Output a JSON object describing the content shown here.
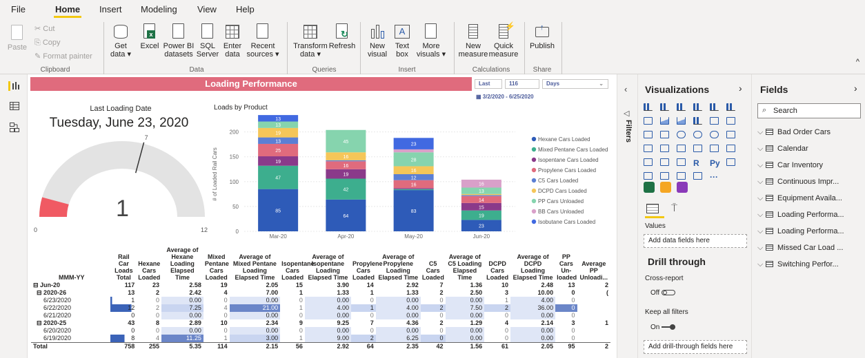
{
  "tabs": [
    "File",
    "Home",
    "Insert",
    "Modeling",
    "View",
    "Help"
  ],
  "ribbon": {
    "clipboard": {
      "paste": "Paste",
      "cut": "Cut",
      "copy": "Copy",
      "format_painter": "Format painter",
      "group": "Clipboard"
    },
    "data": {
      "get_data": "Get",
      "get_data2": "data ▾",
      "excel": "Excel",
      "powerbi": "Power BI",
      "powerbi2": "datasets",
      "sql": "SQL",
      "sql2": "Server",
      "enter": "Enter",
      "enter2": "data",
      "recent": "Recent",
      "recent2": "sources ▾",
      "group": "Data"
    },
    "queries": {
      "transform": "Transform",
      "transform2": "data ▾",
      "refresh": "Refresh",
      "group": "Queries"
    },
    "insert": {
      "new_visual": "New",
      "new_visual2": "visual",
      "text_box": "Text",
      "text_box2": "box",
      "more": "More",
      "more2": "visuals ▾",
      "group": "Insert"
    },
    "calc": {
      "new_measure": "New",
      "new_measure2": "measure",
      "quick": "Quick",
      "quick2": "measure",
      "group": "Calculations"
    },
    "share": {
      "publish": "Publish",
      "group": "Share"
    }
  },
  "report": {
    "title": "Loading Performance",
    "slicer": {
      "mode": "Last",
      "count": "116",
      "unit": "Days",
      "range": "3/2/2020 - 6/25/2020"
    },
    "card": {
      "title": "Last Loading Date",
      "value": "Tuesday, June 23, 2020"
    },
    "gauge": {
      "value": "1",
      "min": "0",
      "max": "12",
      "target": "7",
      "fraction": 0.0833
    }
  },
  "chart_data": {
    "type": "bar",
    "title": "Loads by Product",
    "xlabel": "",
    "ylabel": "# of Loaded Rail Cars",
    "ylim": [
      0,
      230
    ],
    "yticks": [
      0,
      50,
      100,
      150,
      200
    ],
    "categories": [
      "Mar-20",
      "Apr-20",
      "May-20",
      "Jun-20"
    ],
    "series": [
      {
        "name": "Hexane Cars Loaded",
        "color": "#2e5bb8",
        "values": [
          85,
          64,
          83,
          23
        ]
      },
      {
        "name": "Mixed Pentane Cars Loaded",
        "color": "#3dae8e",
        "values": [
          47,
          42,
          2,
          19
        ]
      },
      {
        "name": "Isopentane Cars Loaded",
        "color": "#8a3a8a",
        "values": [
          19,
          19,
          2,
          15
        ]
      },
      {
        "name": "Propylene Cars Loaded",
        "color": "#e06b7d",
        "values": [
          25,
          16,
          16,
          14
        ]
      },
      {
        "name": "C5 Cars Loaded",
        "color": "#5b7fd4",
        "values": [
          13,
          2,
          12,
          2
        ]
      },
      {
        "name": "DCPD Cars Loaded",
        "color": "#f5c659",
        "values": [
          19,
          16,
          16,
          2
        ]
      },
      {
        "name": "PP Cars Unloaded",
        "color": "#86d4ae",
        "values": [
          13,
          45,
          28,
          13
        ]
      },
      {
        "name": "BB Cars Unloaded",
        "color": "#d9a0c9",
        "values": [
          0,
          0,
          6,
          16
        ]
      },
      {
        "name": "Isobutane Cars Loaded",
        "color": "#4169e1",
        "values": [
          13,
          0,
          23,
          0
        ]
      }
    ]
  },
  "table": {
    "headers": [
      "MMM-YY",
      "Rail Car Loads Total",
      "Hexane Cars Loaded",
      "Average of Hexane Loading Elapsed Time",
      "Mixed Pentane Cars Loaded",
      "Average of Mixed Pentane Loading Elapsed Time",
      "Isopentane Cars Loaded",
      "Average of Isopentane Loading Elapsed Time",
      "Propylene Cars Loaded",
      "Average of Propylene Loading Elapsed Time",
      "C5 Cars Loaded",
      "Average of C5 Loading Elapsed Time",
      "DCPD Cars Loaded",
      "Average of DCPD Loading Elapsed Time",
      "PP Cars Un-loaded",
      "Average PP Unloadi..."
    ],
    "rows": [
      {
        "label": "⊟ Jun-20",
        "cls": "b",
        "cells": [
          "117",
          "23",
          "2.58",
          "19",
          "2.05",
          "15",
          "3.90",
          "14",
          "2.92",
          "7",
          "1.36",
          "10",
          "2.48",
          "13",
          "2"
        ]
      },
      {
        "label": "  ⊟ 2020-26",
        "cls": "b",
        "cells": [
          "13",
          "2",
          "2.42",
          "4",
          "7.00",
          "1",
          "1.33",
          "1",
          "1.33",
          "2",
          "2.50",
          "3",
          "10.00",
          "0",
          "("
        ]
      },
      {
        "label": "      6/23/2020",
        "cls": "d",
        "cells": [
          "1",
          "0",
          "0.00",
          "0",
          "0.00",
          "0",
          "0.00",
          "0",
          "0.00",
          "0",
          "0.00",
          "1",
          "4.00",
          "0",
          ""
        ]
      },
      {
        "label": "      6/22/2020",
        "cls": "d",
        "cells": [
          "12",
          "2",
          "7.25",
          "4",
          "21.00",
          "1",
          "4.00",
          "1",
          "4.00",
          "2",
          "7.50",
          "2",
          "36.00",
          "0",
          ""
        ]
      },
      {
        "label": "      6/21/2020",
        "cls": "d",
        "cells": [
          "0",
          "0",
          "0.00",
          "0",
          "0.00",
          "0",
          "0.00",
          "0",
          "0.00",
          "0",
          "0.00",
          "0",
          "0.00",
          "0",
          ""
        ]
      },
      {
        "label": "  ⊟ 2020-25",
        "cls": "b",
        "cells": [
          "43",
          "8",
          "2.89",
          "10",
          "2.34",
          "9",
          "9.25",
          "7",
          "4.36",
          "2",
          "1.29",
          "4",
          "2.14",
          "3",
          "1"
        ]
      },
      {
        "label": "      6/20/2020",
        "cls": "d",
        "cells": [
          "0",
          "0",
          "0.00",
          "0",
          "0.00",
          "0",
          "0.00",
          "0",
          "0.00",
          "0",
          "0.00",
          "0",
          "0.00",
          "0",
          ""
        ]
      },
      {
        "label": "      6/19/2020",
        "cls": "d",
        "cells": [
          "8",
          "4",
          "11.25",
          "1",
          "3.00",
          "1",
          "9.00",
          "2",
          "6.25",
          "0",
          "0.00",
          "0",
          "0.00",
          "0",
          ""
        ]
      },
      {
        "label": "Total",
        "cls": "tot",
        "cells": [
          "758",
          "255",
          "5.35",
          "114",
          "2.15",
          "56",
          "2.92",
          "64",
          "2.35",
          "42",
          "1.56",
          "61",
          "2.05",
          "95",
          "2"
        ]
      }
    ]
  },
  "visualizations": {
    "title": "Visualizations",
    "values_label": "Values",
    "values_placeholder": "Add data fields here",
    "drill_title": "Drill through",
    "cross_report": "Cross-report",
    "cross_state": "Off",
    "keep_filters": "Keep all filters",
    "keep_state": "On",
    "drill_placeholder": "Add drill-through fields here",
    "filters_label": "Filters"
  },
  "fields": {
    "title": "Fields",
    "search_placeholder": "Search",
    "items": [
      "Bad Order Cars",
      "Calendar",
      "Car Inventory",
      "Continuous Impr...",
      "Equipment Availa...",
      "Loading Performa...",
      "Loading Performa...",
      "Missed Car Load ...",
      "Switching Perfor..."
    ]
  }
}
